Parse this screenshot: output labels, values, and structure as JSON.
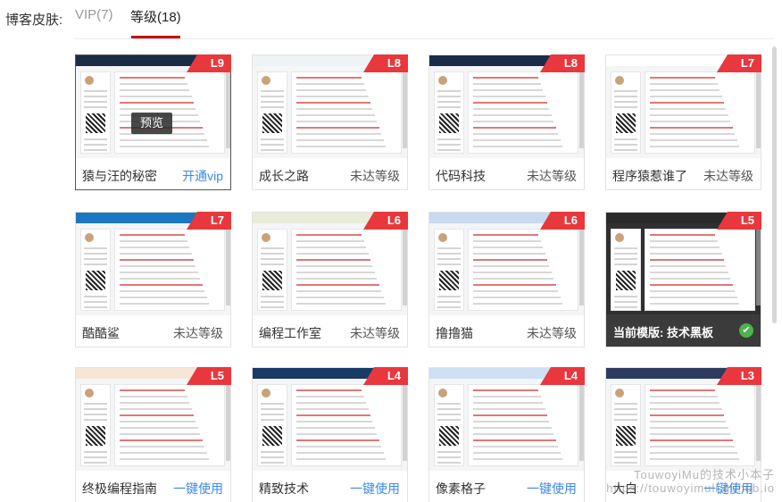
{
  "header": {
    "label": "博客皮肤:",
    "tabs": [
      {
        "label": "VIP(7)"
      },
      {
        "label": "等级(18)"
      }
    ]
  },
  "preview_label": "预览",
  "current": {
    "label": "当前模版:  技术黑板",
    "check": "✔"
  },
  "watermark": {
    "line1": "TouwoyiMu的技术小本子",
    "line2": "https://touwoyimuli.github.io"
  },
  "cards": [
    {
      "name": "猿与汪的秘密",
      "level": "L9",
      "action": "开通vip",
      "action_type": "link",
      "header_color": "#1c2b46"
    },
    {
      "name": "成长之路",
      "level": "L8",
      "action": "未达等级",
      "action_type": "text",
      "header_color": "#eef3f8"
    },
    {
      "name": "代码科技",
      "level": "L8",
      "action": "未达等级",
      "action_type": "text",
      "header_color": "#1b2c4a"
    },
    {
      "name": "程序猿惹谁了",
      "level": "L7",
      "action": "未达等级",
      "action_type": "text",
      "header_color": "#ffffff"
    },
    {
      "name": "酷酷鲨",
      "level": "L7",
      "action": "未达等级",
      "action_type": "text",
      "header_color": "#1a78c2"
    },
    {
      "name": "编程工作室",
      "level": "L6",
      "action": "未达等级",
      "action_type": "text",
      "header_color": "#e9ecd8"
    },
    {
      "name": "撸撸猫",
      "level": "L6",
      "action": "未达等级",
      "action_type": "text",
      "header_color": "#c9d9ef"
    },
    {
      "name": "技术黑板",
      "level": "L5",
      "action": "",
      "action_type": "current",
      "header_color": "#2a2a2a"
    },
    {
      "name": "终极编程指南",
      "level": "L5",
      "action": "一键使用",
      "action_type": "link",
      "header_color": "#f7e6d6"
    },
    {
      "name": "精致技术",
      "level": "L4",
      "action": "一键使用",
      "action_type": "link",
      "header_color": "#173a66"
    },
    {
      "name": "像素格子",
      "level": "L4",
      "action": "一键使用",
      "action_type": "link",
      "header_color": "#cfe0f3"
    },
    {
      "name": "大白",
      "level": "L3",
      "action": "一键使用",
      "action_type": "link",
      "header_color": "#2b3c5e"
    }
  ]
}
